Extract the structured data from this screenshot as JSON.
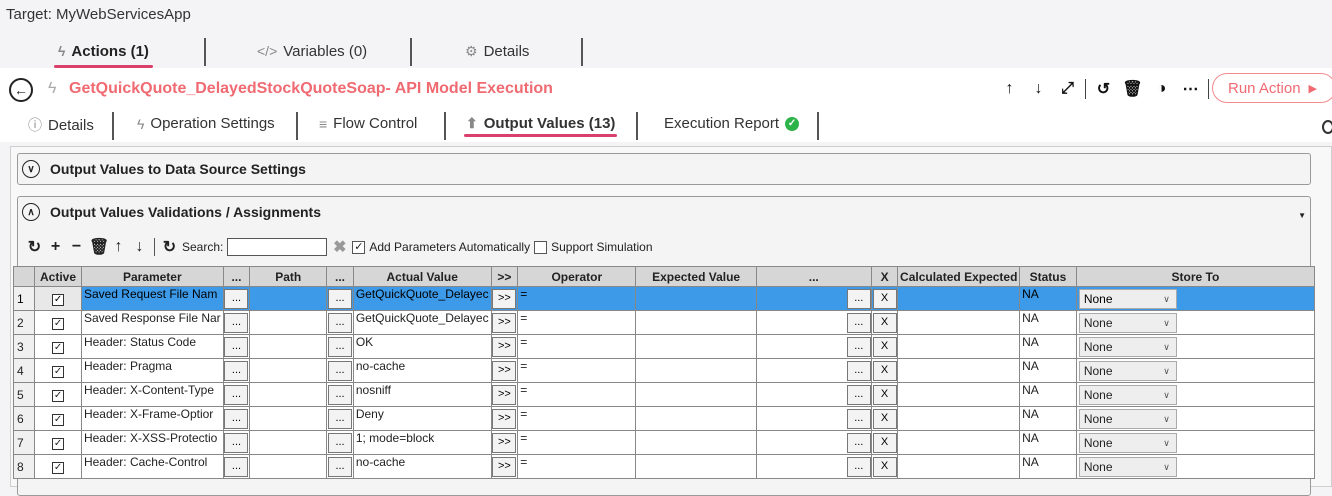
{
  "target": "Target: MyWebServicesApp",
  "top_tabs": [
    {
      "label": "Actions (1)",
      "icon": "bolt-icon"
    },
    {
      "label": "Variables (0)",
      "icon": "code-icon"
    },
    {
      "label": "Details",
      "icon": "gear-icon"
    }
  ],
  "action": {
    "title": "GetQuickQuote_DelayedStockQuoteSoap- API Model Execution",
    "run_label": "Run Action",
    "accent_color": "#f06a72"
  },
  "sub_tabs": [
    {
      "label": "Details",
      "icon": "info-icon"
    },
    {
      "label": "Operation Settings",
      "icon": "bolt-icon"
    },
    {
      "label": "Flow Control",
      "icon": "flow-icon"
    },
    {
      "label": "Output Values (13)",
      "icon": "upload-icon"
    },
    {
      "label": "Execution Report",
      "icon": "check-circle-icon"
    }
  ],
  "panels": {
    "data_source": "Output Values to Data Source Settings",
    "validations": "Output Values Validations / Assignments"
  },
  "grid_toolbar": {
    "search_label": "Search:",
    "add_params_label": "Add Parameters Automatically",
    "support_sim_label": "Support Simulation"
  },
  "columns": {
    "active": "Active",
    "parameter": "Parameter",
    "dots": "...",
    "path": "Path",
    "actual": "Actual Value",
    "arrows": ">>",
    "operator": "Operator",
    "expected": "Expected Value",
    "x": "X",
    "calc": "Calculated Expected",
    "status": "Status",
    "store": "Store To"
  },
  "rows": [
    {
      "n": "1",
      "param": "Saved Request File Nam",
      "actual": "GetQuickQuote_Delayec",
      "op": "=",
      "status": "NA",
      "store": "None"
    },
    {
      "n": "2",
      "param": "Saved Response File Nar",
      "actual": "GetQuickQuote_Delayec",
      "op": "=",
      "status": "NA",
      "store": "None"
    },
    {
      "n": "3",
      "param": "Header: Status Code",
      "actual": "OK",
      "op": "=",
      "status": "NA",
      "store": "None"
    },
    {
      "n": "4",
      "param": "Header: Pragma",
      "actual": "no-cache",
      "op": "=",
      "status": "NA",
      "store": "None"
    },
    {
      "n": "5",
      "param": "Header: X-Content-Type",
      "actual": "nosniff",
      "op": "=",
      "status": "NA",
      "store": "None"
    },
    {
      "n": "6",
      "param": "Header: X-Frame-Optior",
      "actual": "Deny",
      "op": "=",
      "status": "NA",
      "store": "None"
    },
    {
      "n": "7",
      "param": "Header: X-XSS-Protectio",
      "actual": "1; mode=block",
      "op": "=",
      "status": "NA",
      "store": "None"
    },
    {
      "n": "8",
      "param": "Header: Cache-Control",
      "actual": "no-cache",
      "op": "=",
      "status": "NA",
      "store": "None"
    }
  ],
  "btn": {
    "dots": "...",
    "arrows": ">>",
    "x": "X"
  }
}
